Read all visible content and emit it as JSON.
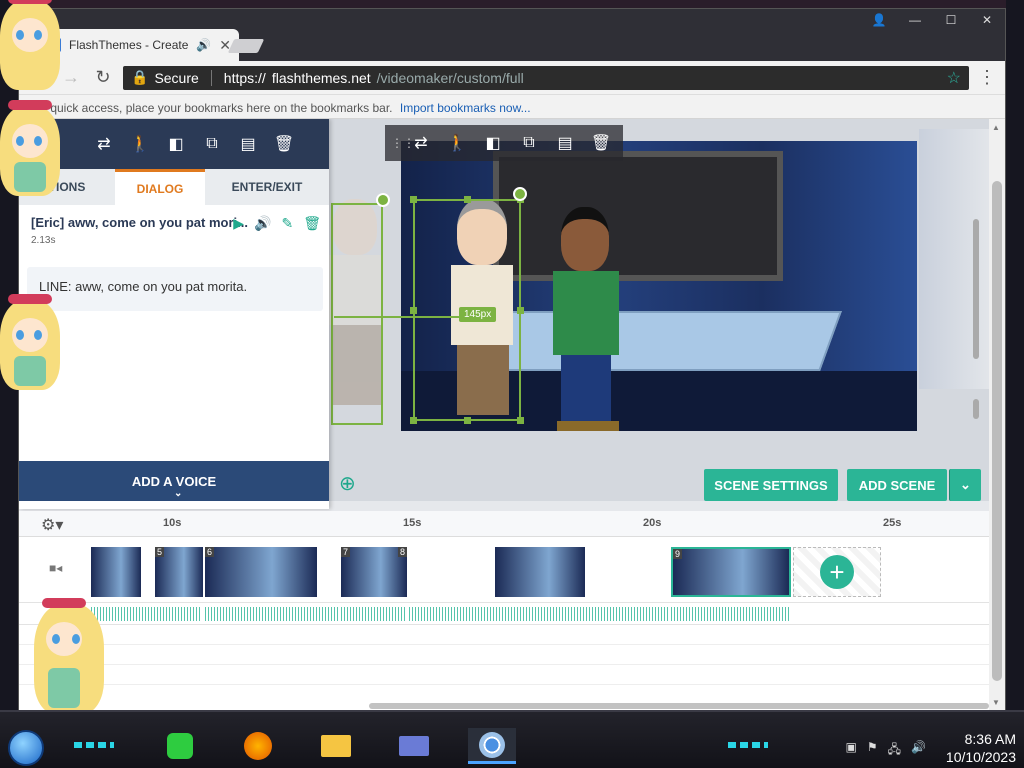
{
  "browser": {
    "tab_title": "FlashThemes - Create",
    "secure_label": "Secure",
    "url_scheme": "https://",
    "url_host": "flashthemes.net",
    "url_path": "/videomaker/custom/full",
    "bookmarks_hint": "For quick access, place your bookmarks here on the bookmarks bar.",
    "bookmarks_link": "Import bookmarks now..."
  },
  "panel": {
    "tabs": [
      "TIONS",
      "DIALOG",
      "ENTER/EXIT"
    ],
    "active_tab": "DIALOG",
    "line_title": "[Eric] aww, come on you pat mori...",
    "line_duration": "2.13s",
    "line_text": "LINE: aww, come on you pat morita.",
    "add_voice_label": "ADD A VOICE"
  },
  "stage": {
    "measure_label": "145px"
  },
  "actions": {
    "scene_settings_label": "SCENE SETTINGS",
    "add_scene_label": "ADD SCENE"
  },
  "timeline": {
    "ticks": [
      "10s",
      "15s",
      "20s",
      "25s"
    ],
    "clip_numbers": [
      "5",
      "6",
      "7",
      "8",
      "9"
    ]
  },
  "taskbar": {
    "time": "8:36 AM",
    "date": "10/10/2023"
  },
  "colors": {
    "accent": "#2bb596",
    "dialog_tab": "#e07a1f",
    "selection": "#7cb342"
  }
}
